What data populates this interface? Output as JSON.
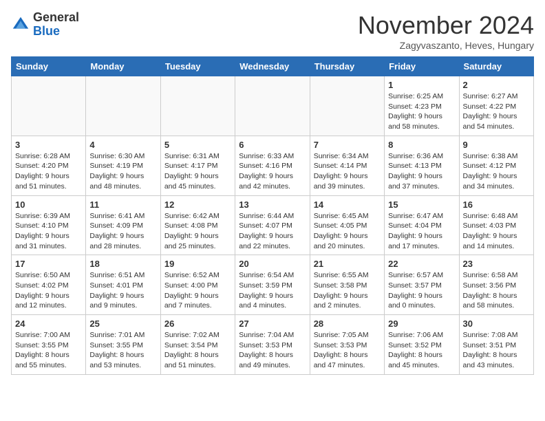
{
  "header": {
    "logo_general": "General",
    "logo_blue": "Blue",
    "month_title": "November 2024",
    "location": "Zagyvaszanto, Heves, Hungary"
  },
  "days_of_week": [
    "Sunday",
    "Monday",
    "Tuesday",
    "Wednesday",
    "Thursday",
    "Friday",
    "Saturday"
  ],
  "weeks": [
    [
      {
        "day": "",
        "info": ""
      },
      {
        "day": "",
        "info": ""
      },
      {
        "day": "",
        "info": ""
      },
      {
        "day": "",
        "info": ""
      },
      {
        "day": "",
        "info": ""
      },
      {
        "day": "1",
        "info": "Sunrise: 6:25 AM\nSunset: 4:23 PM\nDaylight: 9 hours\nand 58 minutes."
      },
      {
        "day": "2",
        "info": "Sunrise: 6:27 AM\nSunset: 4:22 PM\nDaylight: 9 hours\nand 54 minutes."
      }
    ],
    [
      {
        "day": "3",
        "info": "Sunrise: 6:28 AM\nSunset: 4:20 PM\nDaylight: 9 hours\nand 51 minutes."
      },
      {
        "day": "4",
        "info": "Sunrise: 6:30 AM\nSunset: 4:19 PM\nDaylight: 9 hours\nand 48 minutes."
      },
      {
        "day": "5",
        "info": "Sunrise: 6:31 AM\nSunset: 4:17 PM\nDaylight: 9 hours\nand 45 minutes."
      },
      {
        "day": "6",
        "info": "Sunrise: 6:33 AM\nSunset: 4:16 PM\nDaylight: 9 hours\nand 42 minutes."
      },
      {
        "day": "7",
        "info": "Sunrise: 6:34 AM\nSunset: 4:14 PM\nDaylight: 9 hours\nand 39 minutes."
      },
      {
        "day": "8",
        "info": "Sunrise: 6:36 AM\nSunset: 4:13 PM\nDaylight: 9 hours\nand 37 minutes."
      },
      {
        "day": "9",
        "info": "Sunrise: 6:38 AM\nSunset: 4:12 PM\nDaylight: 9 hours\nand 34 minutes."
      }
    ],
    [
      {
        "day": "10",
        "info": "Sunrise: 6:39 AM\nSunset: 4:10 PM\nDaylight: 9 hours\nand 31 minutes."
      },
      {
        "day": "11",
        "info": "Sunrise: 6:41 AM\nSunset: 4:09 PM\nDaylight: 9 hours\nand 28 minutes."
      },
      {
        "day": "12",
        "info": "Sunrise: 6:42 AM\nSunset: 4:08 PM\nDaylight: 9 hours\nand 25 minutes."
      },
      {
        "day": "13",
        "info": "Sunrise: 6:44 AM\nSunset: 4:07 PM\nDaylight: 9 hours\nand 22 minutes."
      },
      {
        "day": "14",
        "info": "Sunrise: 6:45 AM\nSunset: 4:05 PM\nDaylight: 9 hours\nand 20 minutes."
      },
      {
        "day": "15",
        "info": "Sunrise: 6:47 AM\nSunset: 4:04 PM\nDaylight: 9 hours\nand 17 minutes."
      },
      {
        "day": "16",
        "info": "Sunrise: 6:48 AM\nSunset: 4:03 PM\nDaylight: 9 hours\nand 14 minutes."
      }
    ],
    [
      {
        "day": "17",
        "info": "Sunrise: 6:50 AM\nSunset: 4:02 PM\nDaylight: 9 hours\nand 12 minutes."
      },
      {
        "day": "18",
        "info": "Sunrise: 6:51 AM\nSunset: 4:01 PM\nDaylight: 9 hours\nand 9 minutes."
      },
      {
        "day": "19",
        "info": "Sunrise: 6:52 AM\nSunset: 4:00 PM\nDaylight: 9 hours\nand 7 minutes."
      },
      {
        "day": "20",
        "info": "Sunrise: 6:54 AM\nSunset: 3:59 PM\nDaylight: 9 hours\nand 4 minutes."
      },
      {
        "day": "21",
        "info": "Sunrise: 6:55 AM\nSunset: 3:58 PM\nDaylight: 9 hours\nand 2 minutes."
      },
      {
        "day": "22",
        "info": "Sunrise: 6:57 AM\nSunset: 3:57 PM\nDaylight: 9 hours\nand 0 minutes."
      },
      {
        "day": "23",
        "info": "Sunrise: 6:58 AM\nSunset: 3:56 PM\nDaylight: 8 hours\nand 58 minutes."
      }
    ],
    [
      {
        "day": "24",
        "info": "Sunrise: 7:00 AM\nSunset: 3:55 PM\nDaylight: 8 hours\nand 55 minutes."
      },
      {
        "day": "25",
        "info": "Sunrise: 7:01 AM\nSunset: 3:55 PM\nDaylight: 8 hours\nand 53 minutes."
      },
      {
        "day": "26",
        "info": "Sunrise: 7:02 AM\nSunset: 3:54 PM\nDaylight: 8 hours\nand 51 minutes."
      },
      {
        "day": "27",
        "info": "Sunrise: 7:04 AM\nSunset: 3:53 PM\nDaylight: 8 hours\nand 49 minutes."
      },
      {
        "day": "28",
        "info": "Sunrise: 7:05 AM\nSunset: 3:53 PM\nDaylight: 8 hours\nand 47 minutes."
      },
      {
        "day": "29",
        "info": "Sunrise: 7:06 AM\nSunset: 3:52 PM\nDaylight: 8 hours\nand 45 minutes."
      },
      {
        "day": "30",
        "info": "Sunrise: 7:08 AM\nSunset: 3:51 PM\nDaylight: 8 hours\nand 43 minutes."
      }
    ]
  ]
}
